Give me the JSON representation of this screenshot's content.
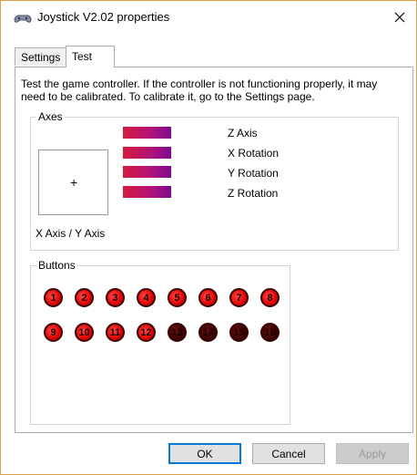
{
  "window": {
    "title": "Joystick V2.02 properties",
    "close_icon": "close-icon"
  },
  "tabs": [
    {
      "label": "Settings",
      "active": false
    },
    {
      "label": "Test",
      "active": true
    }
  ],
  "description": "Test the game controller.  If the controller is not functioning properly, it may need to be calibrated.  To calibrate it, go to the Settings page.",
  "axes": {
    "group_label": "Axes",
    "xy_label": "X Axis / Y Axis",
    "xy_cursor": "+",
    "bars": [
      {
        "label": "Z Axis"
      },
      {
        "label": "X Rotation"
      },
      {
        "label": "Y Rotation"
      },
      {
        "label": "Z Rotation"
      }
    ]
  },
  "buttons": {
    "group_label": "Buttons",
    "items": [
      {
        "label": "1",
        "pressed": true
      },
      {
        "label": "2",
        "pressed": true
      },
      {
        "label": "3",
        "pressed": true
      },
      {
        "label": "4",
        "pressed": true
      },
      {
        "label": "5",
        "pressed": true
      },
      {
        "label": "6",
        "pressed": true
      },
      {
        "label": "7",
        "pressed": true
      },
      {
        "label": "8",
        "pressed": true
      },
      {
        "label": "9",
        "pressed": true
      },
      {
        "label": "10",
        "pressed": true
      },
      {
        "label": "11",
        "pressed": true
      },
      {
        "label": "12",
        "pressed": true
      },
      {
        "label": "13",
        "pressed": false
      },
      {
        "label": "14",
        "pressed": false
      },
      {
        "label": "15",
        "pressed": false
      },
      {
        "label": "16",
        "pressed": false
      }
    ]
  },
  "footer": {
    "ok_label": "OK",
    "cancel_label": "Cancel",
    "apply_label": "Apply"
  },
  "colors": {
    "button_on": "#e30000",
    "button_off": "#3a0000",
    "focus_border": "#0078d7"
  }
}
